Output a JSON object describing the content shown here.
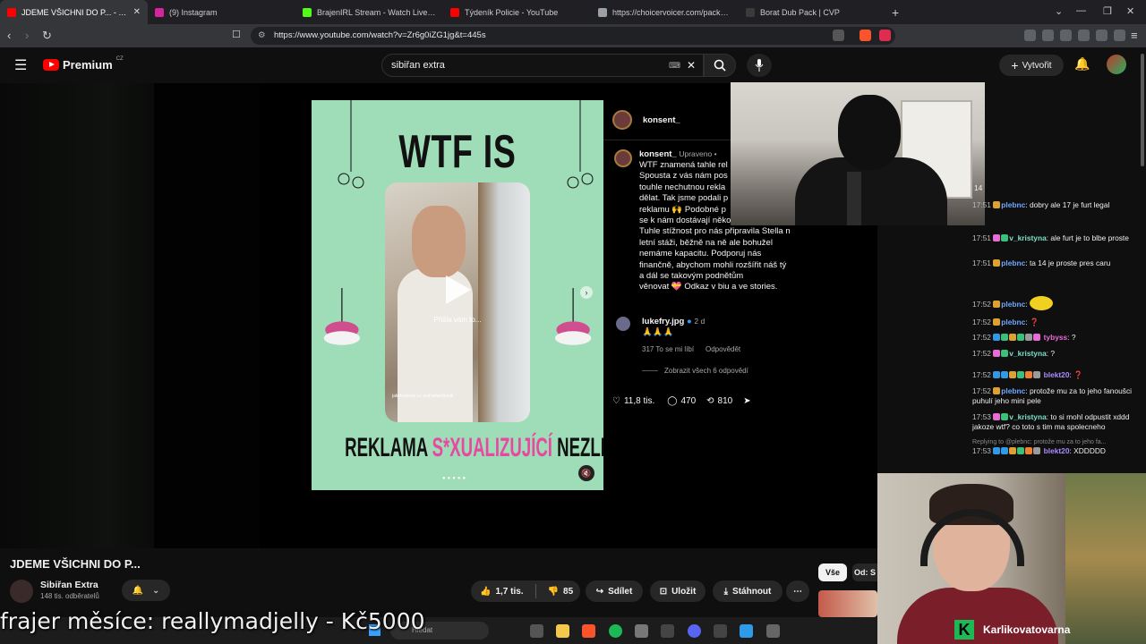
{
  "browser": {
    "tabs": [
      {
        "label": "JDEME VŠICHNI DO P... - YouTube",
        "color": "#ff0000",
        "active": true
      },
      {
        "label": "(9) Instagram",
        "color": "#d6249f",
        "active": false
      },
      {
        "label": "BrajenIRL Stream - Watch Live on Kick",
        "color": "#53fc18",
        "active": false
      },
      {
        "label": "Týdeník Policie - YouTube",
        "color": "#ff0000",
        "active": false
      },
      {
        "label": "https://choicervoicer.com/packs/borat",
        "color": "#9aa0a6",
        "active": false
      },
      {
        "label": "Borat Dub Pack | CVP",
        "color": "#3a3a3a",
        "active": false
      }
    ],
    "new_tab": "+",
    "url": "https://www.youtube.com/watch?v=Zr6g0iZG1jg&t=445s"
  },
  "youtube": {
    "logo_text": "Premium",
    "logo_region": "CZ",
    "search_value": "sibiřan extra",
    "create_label": "Vytvořit",
    "video_title": "JDEME VŠICHNI DO P...",
    "channel_name": "Sibiřan Extra",
    "channel_subs": "148 tis. odběratelů",
    "likes": "1,7 tis.",
    "dislikes": "85",
    "share_label": "Sdílet",
    "save_label": "Uložit",
    "download_label": "Stáhnout",
    "chip_all": "Vše",
    "chip_from": "Od: S"
  },
  "post": {
    "headline": "WTF IS",
    "bottom_pre": "REKLAMA ",
    "bottom_pink": "S*XUALIZUJÍCÍ",
    "bottom_post": " NEZLETILÝ.",
    "play_caption": "Přišla vám to...",
    "phone_credit": "jakokelevne.cz and adambonik"
  },
  "instagram": {
    "account": "konsent_",
    "caption_user": "konsent_",
    "caption_edited": "Upraveno •",
    "caption_lines": [
      "WTF znamená tahle rel",
      "Spousta z vás nám pos",
      "touhle nechutnou rekla",
      "dělat. Tak jsme podali p",
      "reklamu 🙌 Podobné p",
      "se k nám dostávají několikrát za měsíc.",
      "Tuhle stížnost pro nás připravila Stella n",
      "letní stáži, běžně na ně ale bohužel",
      "nemáme kapacitu. Podporuj nás",
      "finančně, abychom mohli rozšířit náš tý",
      "a dál se takovým podnětům",
      "věnovat 💝 Odkaz v biu a ve stories."
    ],
    "comment_user": "lukefry.jpg",
    "comment_age": "2 d",
    "comment_text": "🙏🙏🙏",
    "comment_likes": "317 To se mi líbí",
    "comment_reply": "Odpovědět",
    "view_replies": "Zobrazit všech 6 odpovědí",
    "likes": "11,8 tis.",
    "comments": "470",
    "shares": "810"
  },
  "chat": {
    "viewer_count": "14",
    "messages": [
      {
        "time": "17:51",
        "user": "plebnc",
        "color": "#6fa8ff",
        "text": " dobry ale 17 je furt legal"
      },
      {
        "time": "17:51",
        "user": "v_kristyna",
        "color": "#7ce0c6",
        "text": " ale furt je to blbe proste"
      },
      {
        "time": "17:51",
        "user": "plebnc",
        "color": "#6fa8ff",
        "text": " ta 14 je proste pres caru"
      },
      {
        "time": "17:52",
        "user": "plebnc",
        "color": "#6fa8ff",
        "text": " "
      },
      {
        "time": "17:52",
        "user": "plebnc",
        "color": "#6fa8ff",
        "text": " ❓"
      },
      {
        "time": "17:52",
        "user": "tybyss",
        "color": "#e86bd6",
        "text": " ?"
      },
      {
        "time": "17:52",
        "user": "v_kristyna",
        "color": "#7ce0c6",
        "text": " ?"
      },
      {
        "time": "17:52",
        "user": "blekt20",
        "color": "#a98cff",
        "text": " ❓"
      },
      {
        "time": "17:52",
        "user": "plebnc",
        "color": "#6fa8ff",
        "text": " protože mu za to jeho fanoušci puhulí jeho mini pele"
      },
      {
        "time": "17:53",
        "user": "v_kristyna",
        "color": "#7ce0c6",
        "text": " to si mohl odpustit xddd jakoze wtf? co toto s tim ma spolecneho"
      },
      {
        "time": "",
        "user": "",
        "color": "#888",
        "text": "Replying to @plebnc: protože mu za to jeho fa..."
      },
      {
        "time": "17:53",
        "user": "blekt20",
        "color": "#a98cff",
        "text": " XDDDDD"
      }
    ]
  },
  "overlay": {
    "ticker": "frajer měsíce: reallymadjelly - Kč5000",
    "streamer_name": "Karlikovatovarna",
    "streamer_badge": "K",
    "taskbar_search": "Hledat"
  }
}
